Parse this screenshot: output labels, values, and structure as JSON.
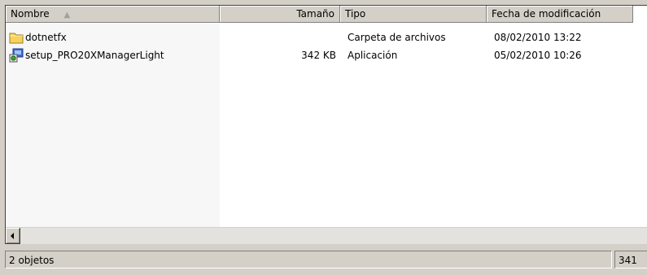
{
  "columns": {
    "name": "Nombre",
    "size": "Tamaño",
    "type": "Tipo",
    "date": "Fecha de modificación"
  },
  "sort_indicator": "▲",
  "files": [
    {
      "name": "dotnetfx",
      "size": "",
      "type": "Carpeta de archivos",
      "modified": "08/02/2010 13:22",
      "icon": "folder-icon"
    },
    {
      "name": "setup_PRO20XManagerLight",
      "size": "342 KB",
      "type": "Aplicación",
      "modified": "05/02/2010 10:26",
      "icon": "setup-app-icon"
    }
  ],
  "status": {
    "count": "2 objetos",
    "size": "341"
  },
  "colors": {
    "window_bg": "#d4d0c8",
    "name_column_bg": "#f7f7f7",
    "folder_yellow": "#f5d35e"
  }
}
